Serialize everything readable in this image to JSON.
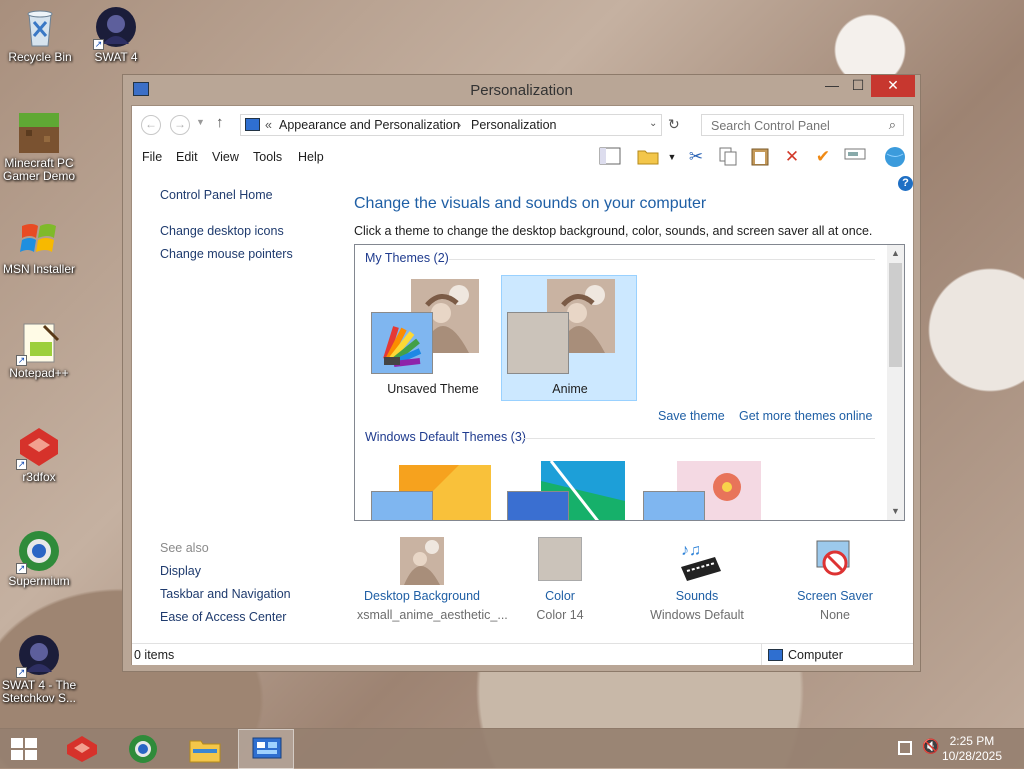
{
  "desktop": {
    "icons": [
      {
        "label": "Recycle Bin",
        "icon": "recycle-bin-icon"
      },
      {
        "label": "SWAT 4",
        "icon": "swat4-icon"
      },
      {
        "label": "Minecraft PC Gamer Demo",
        "icon": "minecraft-icon"
      },
      {
        "label": "MSN Installer",
        "icon": "msn-icon"
      },
      {
        "label": "Notepad++",
        "icon": "notepadpp-icon"
      },
      {
        "label": "r3dfox",
        "icon": "r3dfox-icon"
      },
      {
        "label": "Supermium",
        "icon": "supermium-icon"
      },
      {
        "label": "SWAT 4 - The Stetchkov S...",
        "icon": "swat4-stetchkov-icon"
      }
    ]
  },
  "window": {
    "title": "Personalization",
    "controls": {
      "minimize": "—",
      "maximize": "☐",
      "close": "✕"
    },
    "address": {
      "prefix": "«",
      "crumbs": [
        "Appearance and Personalization",
        "Personalization"
      ],
      "separator": "›"
    },
    "search": {
      "placeholder": "Search Control Panel"
    },
    "menu": [
      "File",
      "Edit",
      "View",
      "Tools",
      "Help"
    ],
    "help_glyph": "?"
  },
  "sidebar": {
    "home": "Control Panel Home",
    "links": [
      "Change desktop icons",
      "Change mouse pointers"
    ],
    "see_also_title": "See also",
    "see_also": [
      "Display",
      "Taskbar and Navigation",
      "Ease of Access Center"
    ]
  },
  "main": {
    "heading": "Change the visuals and sounds on your computer",
    "description": "Click a theme to change the desktop background, color, sounds, and screen saver all at once.",
    "my_themes_title": "My Themes (2)",
    "my_themes": [
      {
        "name": "Unsaved Theme",
        "color": "#7fb6f0",
        "selected": false
      },
      {
        "name": "Anime",
        "color": "#cbc3ba",
        "selected": true
      }
    ],
    "save_theme": "Save theme",
    "get_more": "Get more themes online",
    "default_themes_title": "Windows Default Themes (3)"
  },
  "quick_links": [
    {
      "label": "Desktop Background",
      "value": "xsmall_anime_aesthetic_...",
      "icon": "desktop-background-icon"
    },
    {
      "label": "Color",
      "value": "Color 14",
      "icon": "color-swatch-icon"
    },
    {
      "label": "Sounds",
      "value": "Windows Default",
      "icon": "sounds-icon"
    },
    {
      "label": "Screen Saver",
      "value": "None",
      "icon": "screen-saver-icon"
    }
  ],
  "status": {
    "items": "0 items",
    "location": "Computer"
  },
  "taskbar": {
    "time": "2:25 PM",
    "date": "10/28/2025"
  },
  "colors": {
    "accent_blue": "#1f5fa5",
    "close_red": "#c7372f",
    "selection": "#cce8ff"
  }
}
